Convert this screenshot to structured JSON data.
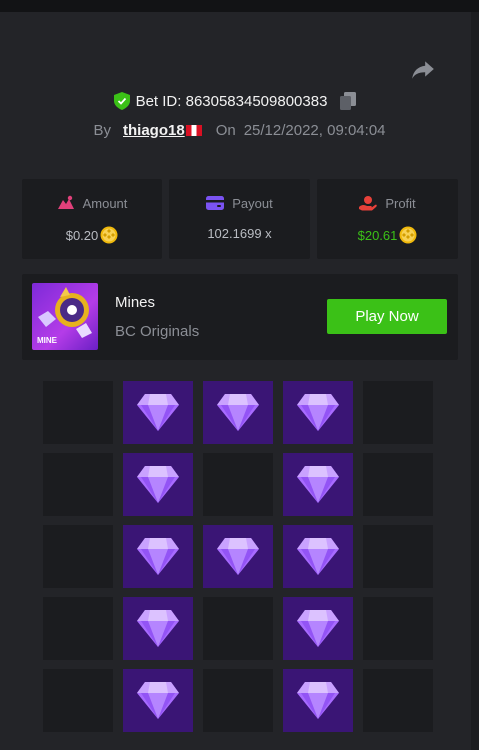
{
  "bet": {
    "id_label": "Bet ID: 86305834509800383",
    "by_label": "By",
    "username": "thiago18",
    "on_label": "On",
    "datetime": "25/12/2022, 09:04:04"
  },
  "stats": {
    "amount": {
      "label": "Amount",
      "value": "$0.20",
      "icon": "amount-icon"
    },
    "payout": {
      "label": "Payout",
      "value": "102.1699 x",
      "icon": "wallet-icon"
    },
    "profit": {
      "label": "Profit",
      "value": "$20.61",
      "icon": "profit-icon"
    }
  },
  "game": {
    "name": "Mines",
    "provider": "BC Originals",
    "thumb_text": "MINE",
    "play_label": "Play Now"
  },
  "board": {
    "rows": 5,
    "cols": 5,
    "cells": [
      [
        0,
        1,
        1,
        1,
        0
      ],
      [
        0,
        1,
        0,
        1,
        0
      ],
      [
        0,
        1,
        1,
        1,
        0
      ],
      [
        0,
        1,
        0,
        1,
        0
      ],
      [
        0,
        1,
        0,
        1,
        0
      ]
    ]
  },
  "colors": {
    "background": "#232428",
    "card": "#1b1c1f",
    "gem_tile": "#3a1575",
    "accent_green": "#3bc117",
    "muted_text": "#8b8e95"
  }
}
